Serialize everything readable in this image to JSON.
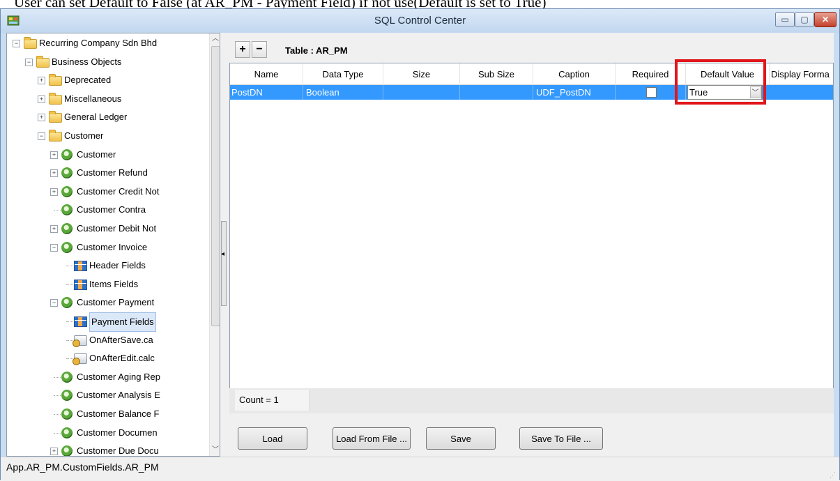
{
  "caption": "User can set Default to False (at AR_PM - Payment Field) if not use(Default is set to True)",
  "window": {
    "title": "SQL Control Center",
    "minimize_label": "▭",
    "maximize_label": "▢",
    "close_label": "✕"
  },
  "tree": {
    "items": [
      {
        "label": "Recurring Company Sdn Bhd",
        "icon": "folder-icon",
        "expander": "-"
      },
      {
        "label": "Business Objects",
        "icon": "folder-icon",
        "expander": "-"
      },
      {
        "label": "Deprecated",
        "icon": "folder-icon",
        "expander": "+"
      },
      {
        "label": "Miscellaneous",
        "icon": "folder-icon",
        "expander": "+"
      },
      {
        "label": "General Ledger",
        "icon": "folder-icon",
        "expander": "+"
      },
      {
        "label": "Customer",
        "icon": "folder-icon",
        "expander": "-"
      },
      {
        "label": "Customer",
        "icon": "business-object-icon",
        "expander": "+"
      },
      {
        "label": "Customer Refund",
        "icon": "business-object-icon",
        "expander": "+"
      },
      {
        "label": "Customer Credit Not",
        "icon": "business-object-icon",
        "expander": "+"
      },
      {
        "label": "Customer Contra",
        "icon": "business-object-icon",
        "expander": ""
      },
      {
        "label": "Customer Debit Not",
        "icon": "business-object-icon",
        "expander": "+"
      },
      {
        "label": "Customer Invoice",
        "icon": "business-object-icon",
        "expander": "-"
      },
      {
        "label": "Header Fields",
        "icon": "table-fields-icon",
        "expander": ""
      },
      {
        "label": "Items Fields",
        "icon": "table-fields-icon",
        "expander": ""
      },
      {
        "label": "Customer Payment",
        "icon": "business-object-icon",
        "expander": "-"
      },
      {
        "label": "Payment Fields",
        "icon": "table-fields-icon",
        "expander": "",
        "selected": true
      },
      {
        "label": "OnAfterSave.ca",
        "icon": "script-icon",
        "expander": ""
      },
      {
        "label": "OnAfterEdit.calc",
        "icon": "script-icon",
        "expander": ""
      },
      {
        "label": "Customer Aging Rep",
        "icon": "business-object-icon",
        "expander": ""
      },
      {
        "label": "Customer Analysis E",
        "icon": "business-object-icon",
        "expander": ""
      },
      {
        "label": "Customer Balance F",
        "icon": "business-object-icon",
        "expander": ""
      },
      {
        "label": "Customer Documen",
        "icon": "business-object-icon",
        "expander": ""
      },
      {
        "label": "Customer Due Docu",
        "icon": "business-object-icon",
        "expander": "+"
      }
    ]
  },
  "toolbar": {
    "add_label": "+",
    "remove_label": "−",
    "table_label": "Table : AR_PM"
  },
  "grid": {
    "columns": [
      "Name",
      "Data Type",
      "Size",
      "Sub Size",
      "Caption",
      "Required",
      "Default Value",
      "Display Forma"
    ],
    "rows": [
      {
        "name": "PostDN",
        "data_type": "Boolean",
        "size": "",
        "sub_size": "",
        "caption": "UDF_PostDN",
        "required": false,
        "default_value": "True",
        "display_format": ""
      }
    ],
    "count_label": "Count = 1"
  },
  "buttons": {
    "load": "Load",
    "load_from_file": "Load From File ...",
    "save": "Save",
    "save_to_file": "Save To File ..."
  },
  "status": {
    "text": "App.AR_PM.CustomFields.AR_PM"
  },
  "colors": {
    "selection": "#3399ff",
    "highlight_box": "#e1161a"
  }
}
